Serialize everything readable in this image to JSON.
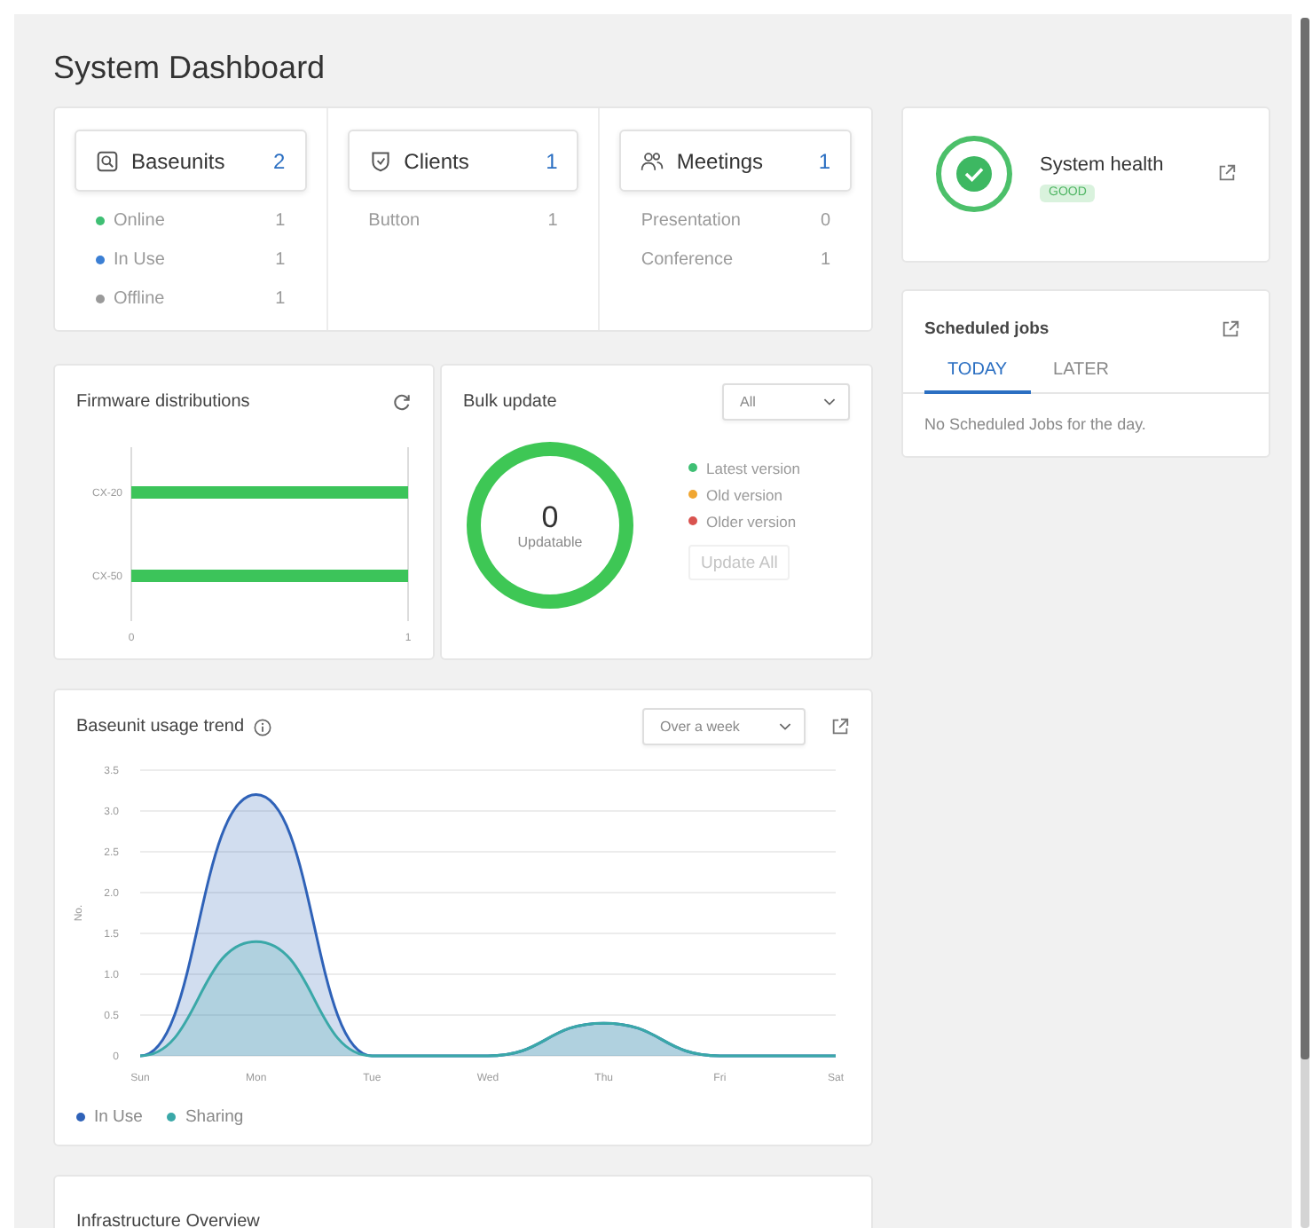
{
  "page_title": "System Dashboard",
  "summary": [
    {
      "label": "Baseunits",
      "count": "2",
      "rows": [
        {
          "label": "Online",
          "value": "1",
          "color": "#3fbf74"
        },
        {
          "label": "In Use",
          "value": "1",
          "color": "#3b7fd4"
        },
        {
          "label": "Offline",
          "value": "1",
          "color": "#9a9a9a"
        }
      ]
    },
    {
      "label": "Clients",
      "count": "1",
      "rows": [
        {
          "label": "Button",
          "value": "1"
        }
      ]
    },
    {
      "label": "Meetings",
      "count": "1",
      "rows": [
        {
          "label": "Presentation",
          "value": "0"
        },
        {
          "label": "Conference",
          "value": "1"
        }
      ]
    }
  ],
  "health": {
    "title": "System health",
    "status": "GOOD"
  },
  "jobs": {
    "title": "Scheduled jobs",
    "tabs": [
      {
        "label": "TODAY",
        "selected": true
      },
      {
        "label": "LATER",
        "selected": false
      }
    ],
    "message": "No Scheduled Jobs for the day."
  },
  "firmware": {
    "title": "Firmware distributions",
    "chart_data": {
      "type": "bar",
      "orientation": "horizontal",
      "categories": [
        "CX-20",
        "CX-50"
      ],
      "values": [
        1,
        1
      ],
      "xlim": [
        0,
        1
      ],
      "xticks": [
        0,
        1
      ]
    }
  },
  "bulk_update": {
    "title": "Bulk update",
    "filter": "All",
    "count": "0",
    "count_label": "Updatable",
    "legend": [
      {
        "label": "Latest version",
        "color": "#3fbf74"
      },
      {
        "label": "Old version",
        "color": "#f0a632"
      },
      {
        "label": "Older version",
        "color": "#d9534f"
      }
    ],
    "action": {
      "label": "Update All",
      "disabled": true
    }
  },
  "usage": {
    "title": "Baseunit usage trend",
    "period": "Over a week",
    "chart_data": {
      "type": "area",
      "ylabel": "No.",
      "categories": [
        "Sun",
        "Mon",
        "Tue",
        "Wed",
        "Thu",
        "Fri",
        "Sat"
      ],
      "ylim": [
        0,
        3.5
      ],
      "yticks": [
        0,
        0.5,
        {
          "value": 1,
          "label": "1.0"
        },
        1.5,
        {
          "value": 2,
          "label": "2.0"
        },
        2.5,
        {
          "value": 3,
          "label": "3.0"
        },
        3.5
      ],
      "grid": true,
      "series": [
        {
          "name": "In Use",
          "color": "#2f62b8",
          "values": [
            0,
            3.2,
            0,
            0,
            0.4,
            0,
            0
          ]
        },
        {
          "name": "Sharing",
          "color": "#3aa8a8",
          "values": [
            0,
            1.4,
            0,
            0,
            0.4,
            0,
            0
          ]
        }
      ]
    }
  },
  "infrastructure": {
    "title": "Infrastructure Overview"
  }
}
